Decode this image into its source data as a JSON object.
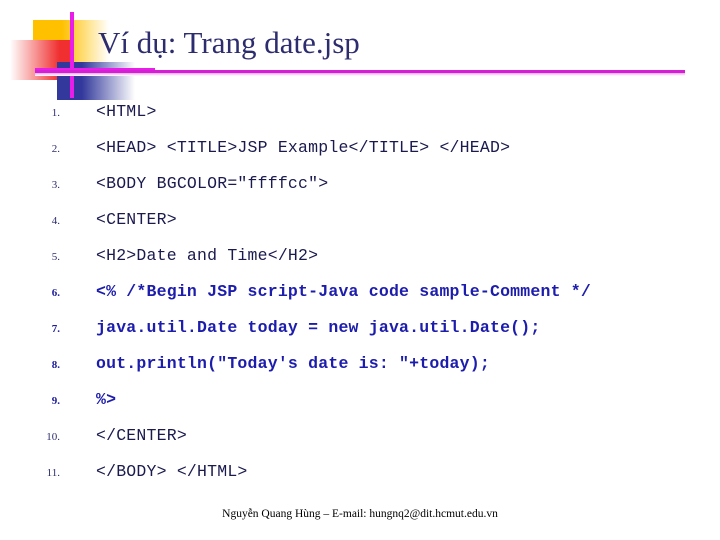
{
  "slide": {
    "title": "Ví dụ: Trang date.jsp",
    "footer": "Nguyễn Quang Hùng – E-mail: hungnq2@dit.hcmut.edu.vn"
  },
  "theme": {
    "title_color": "#2c2c6e",
    "rule_color": "#d41fd4",
    "code_color": "#1a1a4e",
    "code_highlight_color": "#1d1dad",
    "deco_gold": "#ffc000",
    "deco_red": "#f03030",
    "deco_blue": "#33399c",
    "deco_cross": "#e81ee8",
    "background": "#ffffff"
  },
  "code": {
    "lines": [
      {
        "num": "1.",
        "text": "<HTML>",
        "bold": false
      },
      {
        "num": "2.",
        "text": "<HEAD> <TITLE>JSP Example</TITLE> </HEAD>",
        "bold": false
      },
      {
        "num": "3.",
        "text": "<BODY BGCOLOR=\"ffffcc\">",
        "bold": false
      },
      {
        "num": "4.",
        "text": "<CENTER>",
        "bold": false
      },
      {
        "num": "5.",
        "text": "<H2>Date and Time</H2>",
        "bold": false
      },
      {
        "num": "6.",
        "text": "<% /*Begin JSP script-Java code sample-Comment */",
        "bold": true
      },
      {
        "num": "7.",
        "text": "java.util.Date today = new java.util.Date();",
        "bold": true
      },
      {
        "num": "8.",
        "text": "out.println(\"Today's date is: \"+today);",
        "bold": true
      },
      {
        "num": "9.",
        "text": "%>",
        "bold": true
      },
      {
        "num": "10.",
        "text": "</CENTER>",
        "bold": false
      },
      {
        "num": "11.",
        "text": "</BODY> </HTML>",
        "bold": false
      }
    ]
  }
}
